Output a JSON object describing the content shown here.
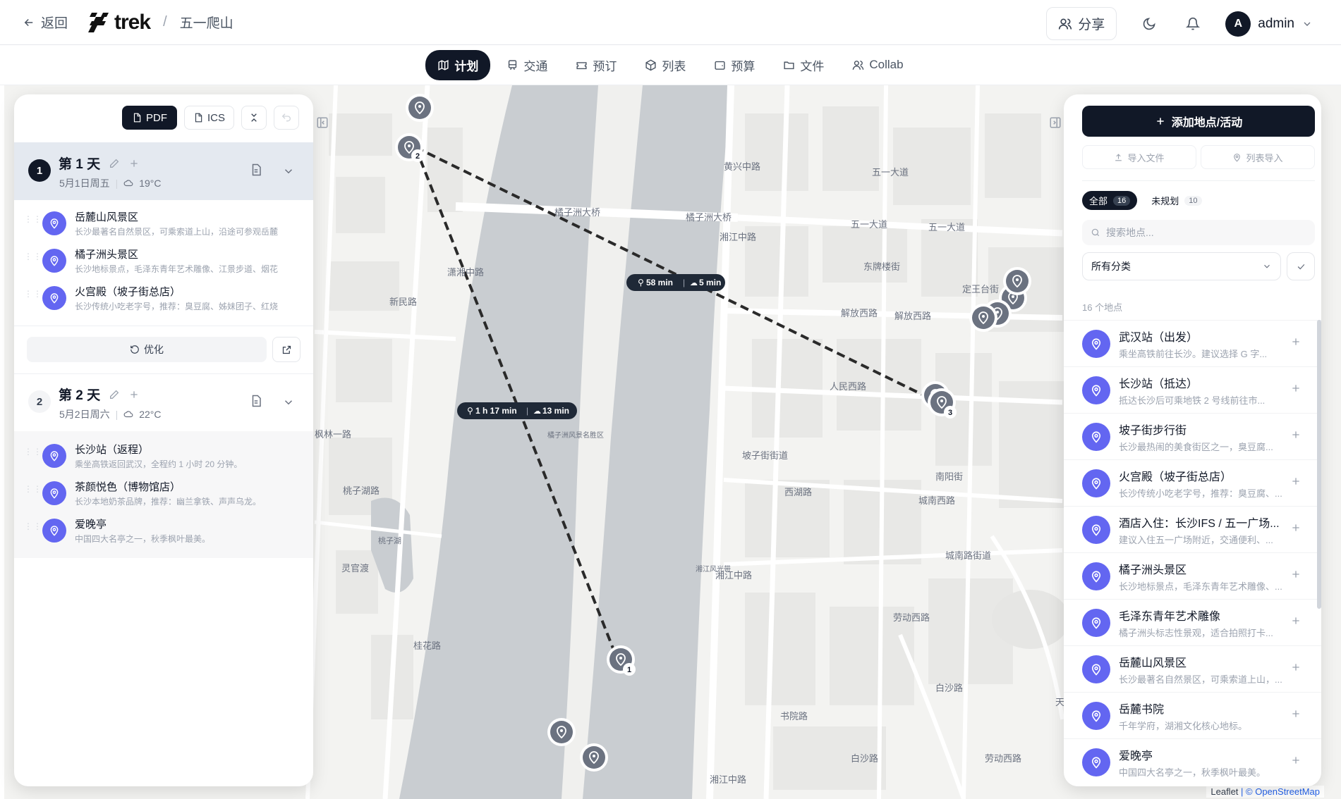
{
  "header": {
    "back_label": "返回",
    "brand": "trek",
    "trip_name": "五一爬山",
    "share_label": "分享",
    "user_initial": "A",
    "user_name": "admin"
  },
  "tabs": [
    {
      "label": "计划",
      "icon": "map-icon",
      "active": true
    },
    {
      "label": "交通",
      "icon": "train-icon"
    },
    {
      "label": "预订",
      "icon": "ticket-icon"
    },
    {
      "label": "列表",
      "icon": "package-icon"
    },
    {
      "label": "预算",
      "icon": "wallet-icon"
    },
    {
      "label": "文件",
      "icon": "folder-icon"
    },
    {
      "label": "Collab",
      "icon": "users-icon"
    }
  ],
  "left_panel": {
    "pdf_label": "PDF",
    "ics_label": "ICS",
    "optimize_label": "优化",
    "days": [
      {
        "num": "1",
        "title": "第 1 天",
        "date": "5月1日周五",
        "weather": "19°C",
        "places": [
          {
            "name": "岳麓山风景区",
            "desc": "长沙最著名自然景区，可乘索道上山，沿途可参观岳麓"
          },
          {
            "name": "橘子洲头景区",
            "desc": "长沙地标景点，毛泽东青年艺术雕像、江景步道、烟花"
          },
          {
            "name": "火宫殿（坡子街总店）",
            "desc": "长沙传统小吃老字号，推荐：臭豆腐、姊妹团子、红烧"
          }
        ]
      },
      {
        "num": "2",
        "title": "第 2 天",
        "date": "5月2日周六",
        "weather": "22°C",
        "places": [
          {
            "name": "长沙站（返程）",
            "desc": "乘坐高铁返回武汉，全程约 1 小时 20 分钟。"
          },
          {
            "name": "茶颜悦色（博物馆店）",
            "desc": "长沙本地奶茶品牌，推荐：幽兰拿铁、声声乌龙。"
          },
          {
            "name": "爱晚亭",
            "desc": "中国四大名亭之一，秋季枫叶最美。"
          }
        ]
      }
    ]
  },
  "right_panel": {
    "add_label": "添加地点/活动",
    "import_file_label": "导入文件",
    "import_list_label": "列表导入",
    "filter_all_label": "全部",
    "filter_all_count": "16",
    "filter_unplanned_label": "未规划",
    "filter_unplanned_count": "10",
    "search_placeholder": "搜索地点...",
    "category_label": "所有分类",
    "count_label": "16 个地点",
    "places": [
      {
        "name": "武汉站（出发）",
        "desc": "乘坐高铁前往长沙。建议选择 G 字..."
      },
      {
        "name": "长沙站（抵达）",
        "desc": "抵达长沙后可乘地铁 2 号线前往市..."
      },
      {
        "name": "坡子街步行街",
        "desc": "长沙最热闹的美食街区之一，臭豆腐..."
      },
      {
        "name": "火宫殿（坡子街总店）",
        "desc": "长沙传统小吃老字号，推荐：臭豆腐、..."
      },
      {
        "name": "酒店入住：长沙IFS / 五一广场...",
        "desc": "建议入住五一广场附近，交通便利、..."
      },
      {
        "name": "橘子洲头景区",
        "desc": "长沙地标景点，毛泽东青年艺术雕像、..."
      },
      {
        "name": "毛泽东青年艺术雕像",
        "desc": "橘子洲头标志性景观，适合拍照打卡..."
      },
      {
        "name": "岳麓山风景区",
        "desc": "长沙最著名自然景区，可乘索道上山，..."
      },
      {
        "name": "岳麓书院",
        "desc": "千年学府，湖湘文化核心地标。"
      },
      {
        "name": "爱晚亭",
        "desc": "中国四大名亭之一，秋季枫叶最美。"
      }
    ]
  },
  "map": {
    "route_labels": [
      {
        "walk": "58 min",
        "drive": "5 min"
      },
      {
        "walk": "1 h 17 min",
        "drive": "13 min"
      }
    ],
    "marker_numbers": [
      "1",
      "2",
      "3"
    ],
    "street_labels": [
      "橘子洲大桥",
      "橘子洲大桥",
      "五一大道",
      "五一大道",
      "解放西路",
      "解放西路",
      "东牌楼街",
      "定王台街",
      "人民西路",
      "坡子街街道",
      "西湖路",
      "城南西路",
      "城南路街道",
      "新民路",
      "桃子湖路",
      "枫林一路",
      "潇湘中路",
      "湘江中路",
      "湘江中路",
      "湘江中路",
      "桂花路",
      "劳动西路",
      "劳动西路",
      "白沙路",
      "书院路",
      "白沙路",
      "黄兴中路",
      "天心路",
      "湘江风光带",
      "橘子洲风景名胜区",
      "桃子湖",
      "五一大道",
      "灵官渡",
      "南阳街"
    ],
    "attribution_leaflet": "Leaflet",
    "attribution_osm": "OpenStreetMap"
  },
  "colors": {
    "primary": "#111827",
    "pin": "#6366f1",
    "map_bg": "#f3f3f1",
    "river": "#c9cdd1",
    "marker": "#6b7280"
  }
}
